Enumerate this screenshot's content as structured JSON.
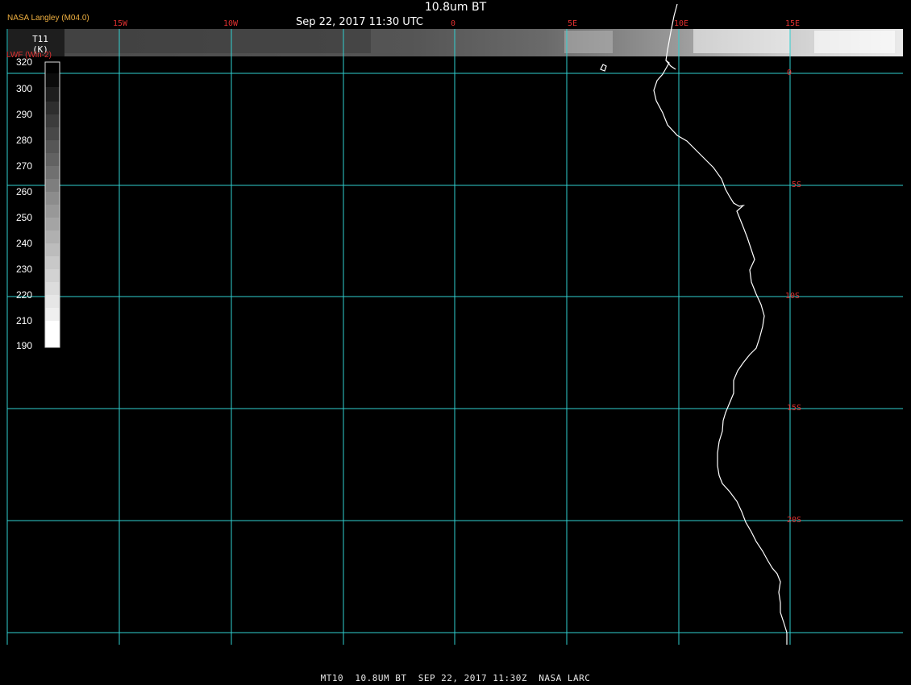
{
  "title": "10.8um BT",
  "subtitle": "Sep 22, 2017 11:30 UTC",
  "organization": "NASA Langley (M04.0)",
  "footer": "MT10  10.8UM BT  SEP 22, 2017 11:30Z  NASA LARC",
  "legend": {
    "variable": "T11",
    "unit": "(K)",
    "source": "LWF (Win-2)",
    "tick_values": [
      "320",
      "300",
      "290",
      "280",
      "270",
      "260",
      "250",
      "240",
      "230",
      "220",
      "210",
      "190"
    ]
  },
  "longitude_labels": [
    "15W",
    "10W",
    "0",
    "5E",
    "10E",
    "15E"
  ],
  "latitude_labels": [
    "0",
    "5S",
    "10S",
    "15S",
    "20S"
  ],
  "colors": {
    "grid": "#30d0d0",
    "grid_label": "#e03030",
    "coastline": "#ffffff",
    "background": "#000000",
    "org_label": "#f0b040"
  }
}
